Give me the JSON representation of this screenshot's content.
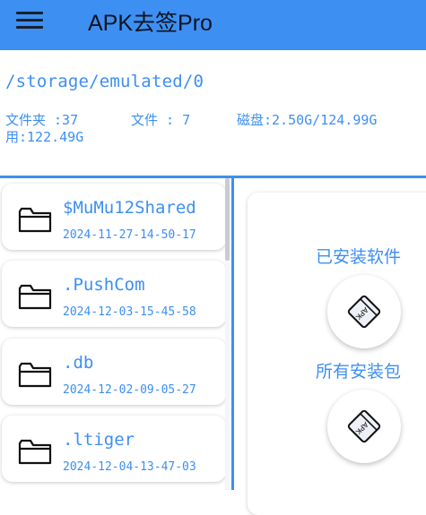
{
  "app": {
    "title": "APK去签Pro",
    "menu_icon": "hamburger-menu-icon",
    "bar_color": "#3d8ff2"
  },
  "path": "/storage/emulated/0",
  "stats": {
    "folders": "文件夹 :37",
    "files": "文件 : 7",
    "disk": "磁盘:2.50G/124.99G",
    "used": "用:122.49G"
  },
  "files": [
    {
      "name": "$MuMu12Shared",
      "date": "2024-11-27-14-50-17",
      "icon": "folder-icon"
    },
    {
      "name": ".PushCom",
      "date": "2024-12-03-15-45-58",
      "icon": "folder-icon"
    },
    {
      "name": ".db",
      "date": "2024-12-02-09-05-27",
      "icon": "folder-icon"
    },
    {
      "name": ".ltiger",
      "date": "2024-12-04-13-47-03",
      "icon": "folder-icon"
    }
  ],
  "actions": {
    "installed_label": "已安装软件",
    "packages_label": "所有安装包",
    "apk_badge": "APK",
    "icon": "apk-icon"
  }
}
